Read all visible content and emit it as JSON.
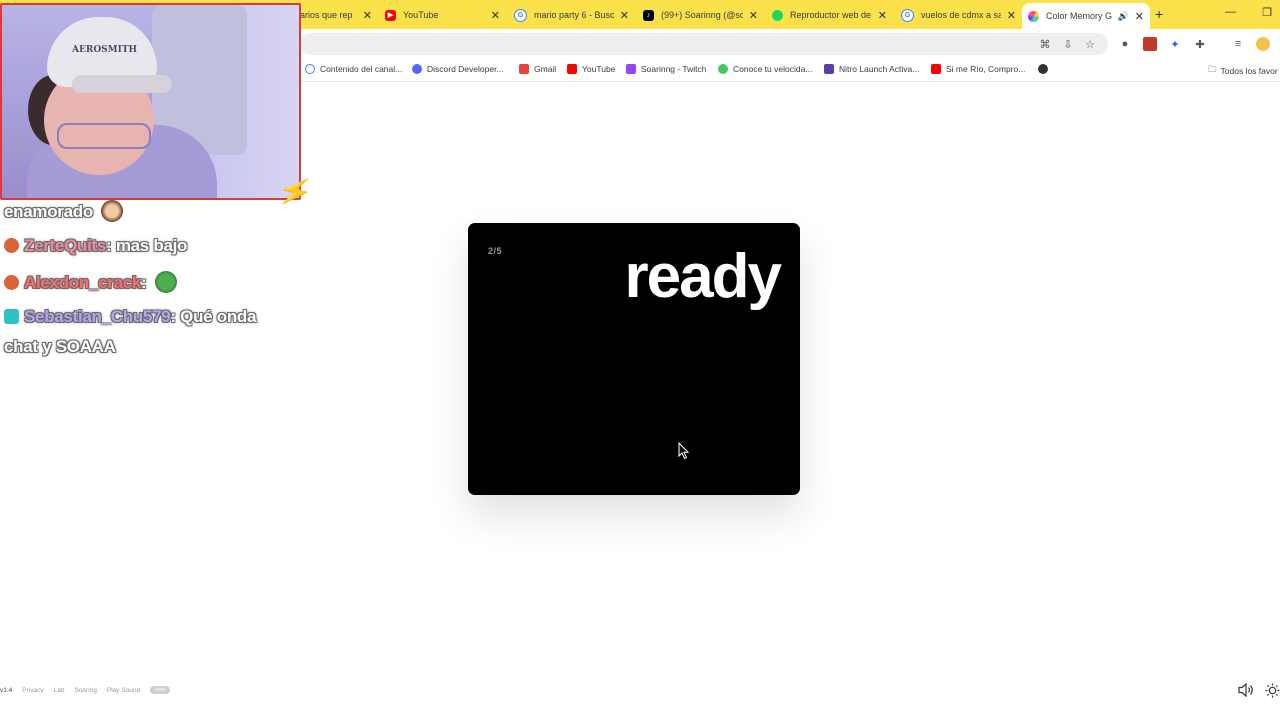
{
  "browser": {
    "tabs": [
      {
        "title": "arios que rep",
        "favicon": "partial-tab-icon",
        "active": false
      },
      {
        "title": "YouTube",
        "favicon": "youtube-icon",
        "active": false
      },
      {
        "title": "mario party 6 - Busca",
        "favicon": "google-icon",
        "active": false
      },
      {
        "title": "(99+) Soarinng (@so",
        "favicon": "tiktok-icon",
        "active": false
      },
      {
        "title": "Reproductor web de",
        "favicon": "spotify-icon",
        "active": false
      },
      {
        "title": "vuelos de cdmx a sa",
        "favicon": "google-icon",
        "active": false
      },
      {
        "title": "Color Memory G",
        "favicon": "color-wheel-icon",
        "active": true
      }
    ],
    "new_tab_label": "+",
    "bookmarks": [
      {
        "label": "Contenido del canal...",
        "icon": "google-icon"
      },
      {
        "label": "Discord Developer...",
        "icon": "discord-icon"
      },
      {
        "label": "Gmail",
        "icon": "gmail-icon"
      },
      {
        "label": "YouTube",
        "icon": "youtube-icon"
      },
      {
        "label": "Soarinng - Twitch",
        "icon": "twitch-icon"
      },
      {
        "label": "Conoce tu velocida...",
        "icon": "speedtest-icon"
      },
      {
        "label": "Nitro Launch Activa...",
        "icon": "nitro-icon"
      },
      {
        "label": "Si me Río, Compro...",
        "icon": "youtube-icon"
      }
    ],
    "bookmarks_folder": "Todos los favor",
    "colors": {
      "tabstrip": "#fbe14a",
      "webcam_border": "#d93a3a"
    }
  },
  "webcam": {
    "cap_text": "AEROSMITH"
  },
  "chat": {
    "messages": [
      {
        "user": "",
        "text": "enamorado",
        "user_color": "#ffffff"
      },
      {
        "user": "ZerteQuits",
        "text": ": mas bajo",
        "user_color": "#f08aa0"
      },
      {
        "user": "Alexdon_crack",
        "text": ":",
        "user_color": "#ff6a6a"
      },
      {
        "user": "Sebastian_Chu579",
        "text": ": Qué onda",
        "user_color": "#b7a2f4"
      },
      {
        "user": "",
        "text": "chat y SOAAA",
        "user_color": "#ffffff"
      }
    ]
  },
  "game": {
    "round": "2/5",
    "status": "ready"
  },
  "footer": {
    "version": "v1.4",
    "links": [
      "Privacy",
      "Lab",
      "Soaring",
      "Play Sound"
    ],
    "badge": "new"
  }
}
